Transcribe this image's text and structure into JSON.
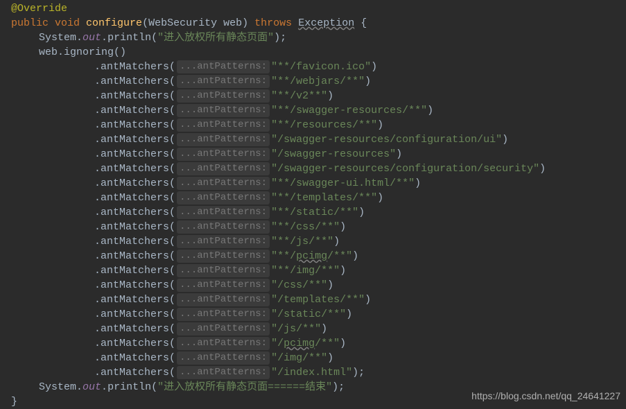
{
  "annotation": "@Override",
  "signature": {
    "modifiers": "public void",
    "method": "configure",
    "paramType": "WebSecurity",
    "paramName": "web",
    "throws": "throws",
    "exception": "Exception",
    "brace": "{"
  },
  "println1": {
    "cls": "System",
    "field": "out",
    "method": "println",
    "str": "\"进入放权所有静态页面\"",
    "end": ");"
  },
  "ignoring": {
    "obj": "web",
    "method": "ignoring",
    "parens": "()"
  },
  "hintLabel": "...antPatterns:",
  "matcherMethod": "antMatchers",
  "paths": [
    {
      "str": "\"**/favicon.ico\"",
      "end": ")"
    },
    {
      "str": "\"**/webjars/**\"",
      "end": ")"
    },
    {
      "str": "\"**/v2**\"",
      "end": ")"
    },
    {
      "str": "\"**/swagger-resources/**\"",
      "end": ")"
    },
    {
      "str": "\"**/resources/**\"",
      "end": ")"
    },
    {
      "str": "\"/swagger-resources/configuration/ui\"",
      "end": ")"
    },
    {
      "str": "\"/swagger-resources\"",
      "end": ")"
    },
    {
      "str": "\"/swagger-resources/configuration/security\"",
      "end": ")"
    },
    {
      "str": "\"**/swagger-ui.html/**\"",
      "end": ")"
    },
    {
      "str": "\"**/templates/**\"",
      "end": ")"
    },
    {
      "str": "\"**/static/**\"",
      "end": ")"
    },
    {
      "str": "\"**/css/**\"",
      "end": ")"
    },
    {
      "str": "\"**/js/**\"",
      "end": ")"
    },
    {
      "str_pre": "\"**/",
      "warn": "pcimg",
      "str_post": "/**\"",
      "end": ")"
    },
    {
      "str": "\"**/img/**\"",
      "end": ")"
    },
    {
      "str": "\"/css/**\"",
      "end": ")"
    },
    {
      "str": "\"/templates/**\"",
      "end": ")"
    },
    {
      "str": "\"/static/**\"",
      "end": ")"
    },
    {
      "str": "\"/js/**\"",
      "end": ")"
    },
    {
      "str_pre": "\"/",
      "warn": "pcimg",
      "str_post": "/**\"",
      "end": ")"
    },
    {
      "str": "\"/img/**\"",
      "end": ")"
    },
    {
      "str": "\"/index.html\"",
      "end": ");"
    }
  ],
  "println2": {
    "cls": "System",
    "field": "out",
    "method": "println",
    "str": "\"进入放权所有静态页面======结束\"",
    "end": ");"
  },
  "closeBrace": "}",
  "watermark": "https://blog.csdn.net/qq_24641227"
}
